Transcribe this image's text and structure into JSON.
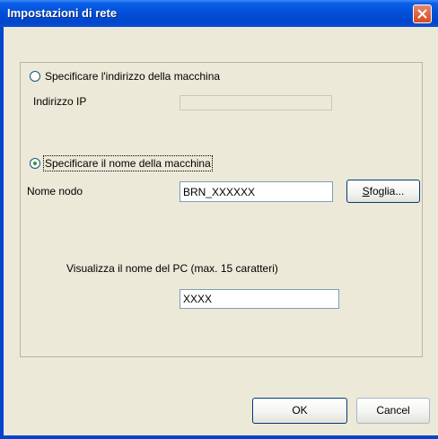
{
  "window": {
    "title": "Impostazioni di rete"
  },
  "options": {
    "address": {
      "label": "Specificare l'indirizzo della macchina",
      "selected": false
    },
    "name": {
      "label": "Specificare il nome della macchina",
      "selected": true
    }
  },
  "ip": {
    "label": "Indirizzo IP",
    "value": ""
  },
  "node": {
    "label": "Nome nodo",
    "value": "BRN_XXXXXX",
    "browse_label": "Sfoglia...",
    "browse_accel": "S",
    "browse_rest": "foglia..."
  },
  "pc_name": {
    "label": "Visualizza il nome del PC (max. 15 caratteri)",
    "value": "XXXX"
  },
  "buttons": {
    "ok": "OK",
    "cancel": "Cancel"
  },
  "icons": {
    "close": "close-icon"
  },
  "colors": {
    "titlebar": "#0046cc",
    "close": "#d8481c",
    "radio_dot": "#21a121"
  }
}
